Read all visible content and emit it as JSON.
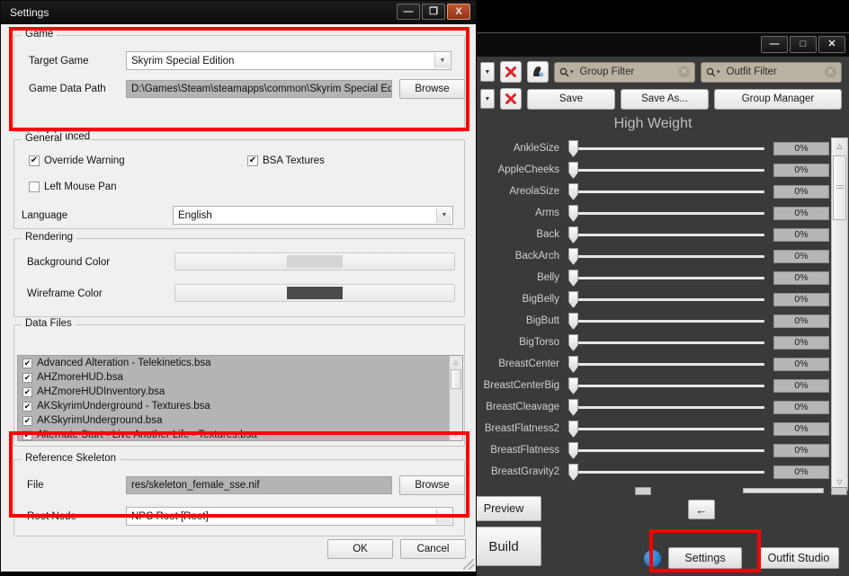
{
  "background_app": {
    "window_buttons": {
      "minimize": "—",
      "maximize": "□",
      "close": "✕"
    },
    "toolbar": {
      "group_filter_placeholder": "Group Filter",
      "outfit_filter_placeholder": "Outfit Filter",
      "save_label": "Save",
      "save_as_label": "Save As...",
      "group_manager_label": "Group Manager",
      "search_prefix": "Q"
    },
    "weight_title": "High Weight",
    "sliders": [
      {
        "name": "AnkleSize",
        "value": "0%"
      },
      {
        "name": "AppleCheeks",
        "value": "0%"
      },
      {
        "name": "AreolaSize",
        "value": "0%"
      },
      {
        "name": "Arms",
        "value": "0%"
      },
      {
        "name": "Back",
        "value": "0%"
      },
      {
        "name": "BackArch",
        "value": "0%"
      },
      {
        "name": "Belly",
        "value": "0%"
      },
      {
        "name": "BigBelly",
        "value": "0%"
      },
      {
        "name": "BigButt",
        "value": "0%"
      },
      {
        "name": "BigTorso",
        "value": "0%"
      },
      {
        "name": "BreastCenter",
        "value": "0%"
      },
      {
        "name": "BreastCenterBig",
        "value": "0%"
      },
      {
        "name": "BreastCleavage",
        "value": "0%"
      },
      {
        "name": "BreastFlatness2",
        "value": "0%"
      },
      {
        "name": "BreastFlatness",
        "value": "0%"
      },
      {
        "name": "BreastGravity2",
        "value": "0%"
      }
    ],
    "bottom": {
      "preview_label": "Preview",
      "build_label": "Build",
      "back_arrow_label": "←",
      "settings_label": "Settings",
      "outfit_studio_label": "Outfit Studio",
      "info_label": "i"
    }
  },
  "dialog": {
    "title": "Settings",
    "window_buttons": {
      "minimize": "—",
      "maximize": "❐",
      "close": "X"
    },
    "game": {
      "legend": "Game",
      "target_game_label": "Target Game",
      "target_game_value": "Skyrim Special Edition",
      "game_data_path_label": "Game Data Path",
      "game_data_path_value": "D:\\Games\\Steam\\steamapps\\common\\Skyrim Special Editic",
      "browse_label": "Browse",
      "advanced_label": "Advanced"
    },
    "general": {
      "legend": "General",
      "override_warning_label": "Override Warning",
      "override_warning_checked": "✔",
      "bsa_textures_label": "BSA Textures",
      "bsa_textures_checked": "✔",
      "left_mouse_pan_label": "Left Mouse Pan",
      "left_mouse_pan_checked": "",
      "language_label": "Language",
      "language_value": "English"
    },
    "rendering": {
      "legend": "Rendering",
      "background_color_label": "Background Color",
      "background_color_value": "#d4d4d4",
      "wireframe_color_label": "Wireframe Color",
      "wireframe_color_value": "#4b4b4b"
    },
    "data_files": {
      "legend": "Data Files",
      "items": [
        {
          "checked": "✔",
          "name": "Advanced Alteration - Telekinetics.bsa"
        },
        {
          "checked": "✔",
          "name": "AHZmoreHUD.bsa"
        },
        {
          "checked": "✔",
          "name": "AHZmoreHUDInventory.bsa"
        },
        {
          "checked": "✔",
          "name": "AKSkyrimUnderground - Textures.bsa"
        },
        {
          "checked": "✔",
          "name": "AKSkyrimUnderground.bsa"
        },
        {
          "checked": "✔",
          "name": "Alternate Start - Live Another Life - Textures.bsa"
        }
      ]
    },
    "reference_skeleton": {
      "legend": "Reference Skeleton",
      "file_label": "File",
      "file_value": "res/skeleton_female_sse.nif",
      "browse_label": "Browse",
      "root_node_label": "Root Node",
      "root_node_value": "NPC Root [Root]"
    },
    "footer": {
      "ok_label": "OK",
      "cancel_label": "Cancel"
    }
  },
  "highlights": {
    "color": "#ff0000"
  }
}
